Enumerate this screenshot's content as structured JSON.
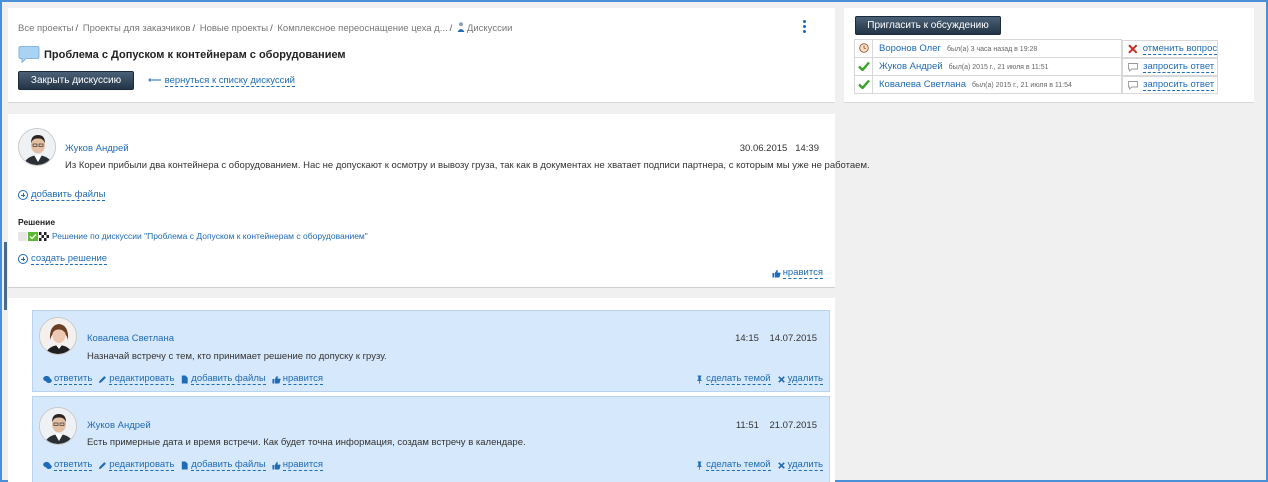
{
  "breadcrumb": {
    "items": [
      "Все проекты",
      "Проекты для заказчиков",
      "Новые проекты",
      "Комплексное переоснащение цеха д..."
    ],
    "current": "Дискуссии",
    "separator": "/"
  },
  "discussion": {
    "title": "Проблема с Допуском к контейнерам с оборудованием",
    "close_button": "Закрыть дискуссию",
    "back_link": "вернуться к списку дискуссий"
  },
  "post": {
    "author": "Жуков Андрей",
    "date": "30.06.2015",
    "time": "14:39",
    "text": "Из Кореи прибыли два контейнера с оборудованием. Нас не допускают к осмотру и вывозу груза, так как в документах не хватает подписи партнера, с которым мы уже не работаем.",
    "add_files": "добавить файлы",
    "solution_label": "Решение",
    "solution_link": "Решение по дискуссии \"Проблема с Допуском к контейнерам с оборудованием\"",
    "create_solution": "создать решение",
    "like": "нравится"
  },
  "comments": [
    {
      "author": "Ковалева Светлана",
      "time": "14:15",
      "date": "14.07.2015",
      "text": "Назначай встречу с тем, кто принимает решение по допуску к грузу.",
      "reply": "ответить",
      "edit": "редактировать",
      "add_files": "добавить файлы",
      "like": "нравится",
      "make_topic": "сделать темой",
      "delete": "удалить"
    },
    {
      "author": "Жуков Андрей",
      "time": "11:51",
      "date": "21.07.2015",
      "text": "Есть примерные дата и время встречи. Как будет точна информация, создам встречу в календаре.",
      "reply": "ответить",
      "edit": "редактировать",
      "add_files": "добавить файлы",
      "like": "нравится",
      "make_topic": "сделать темой",
      "delete": "удалить"
    }
  ],
  "sidebar": {
    "invite_button": "Пригласить к обсуждению",
    "participants": [
      {
        "name": "Воронов Олег",
        "seen": "был(а) 3 часа назад в 19:28",
        "action": "отменить вопрос",
        "status_icon": "clock-icon",
        "action_icon": "cross-icon"
      },
      {
        "name": "Жуков Андрей",
        "seen": "был(а) 2015 г., 21 июля в 11:51",
        "action": "запросить ответ",
        "status_icon": "check-icon",
        "action_icon": "speech-bubble-icon"
      },
      {
        "name": "Ковалева Светлана",
        "seen": "был(а) 2015 г., 21 июля в 11:54",
        "action": "запросить ответ",
        "status_icon": "check-icon",
        "action_icon": "speech-bubble-icon"
      }
    ]
  },
  "colors": {
    "link": "#1e6bb8",
    "comment_bg": "#d6e8fb",
    "button_dark": "#2c3e50",
    "check_green": "#3aa12b",
    "cross_red": "#d0281e"
  }
}
